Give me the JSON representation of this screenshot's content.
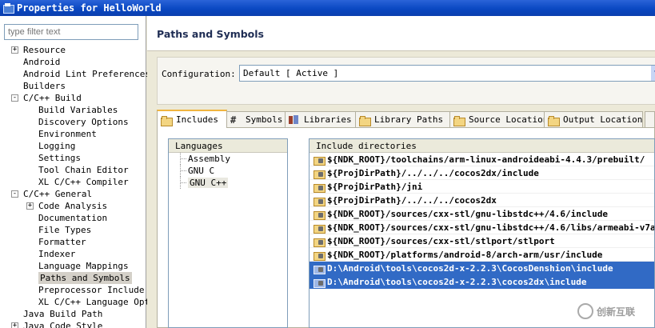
{
  "window": {
    "title": "Properties for HelloWorld"
  },
  "filter": {
    "placeholder": "type filter text"
  },
  "tree": {
    "items": [
      {
        "label": "Resource",
        "level": 0,
        "expander": "+"
      },
      {
        "label": "Android",
        "level": 0
      },
      {
        "label": "Android Lint Preferences",
        "level": 0
      },
      {
        "label": "Builders",
        "level": 0
      },
      {
        "label": "C/C++ Build",
        "level": 0,
        "expander": "-"
      },
      {
        "label": "Build Variables",
        "level": 1
      },
      {
        "label": "Discovery Options",
        "level": 1
      },
      {
        "label": "Environment",
        "level": 1
      },
      {
        "label": "Logging",
        "level": 1
      },
      {
        "label": "Settings",
        "level": 1
      },
      {
        "label": "Tool Chain Editor",
        "level": 1
      },
      {
        "label": "XL C/C++ Compiler",
        "level": 1
      },
      {
        "label": "C/C++ General",
        "level": 0,
        "expander": "-"
      },
      {
        "label": "Code Analysis",
        "level": 1,
        "expander": "+"
      },
      {
        "label": "Documentation",
        "level": 1
      },
      {
        "label": "File Types",
        "level": 1
      },
      {
        "label": "Formatter",
        "level": 1
      },
      {
        "label": "Indexer",
        "level": 1
      },
      {
        "label": "Language Mappings",
        "level": 1
      },
      {
        "label": "Paths and Symbols",
        "level": 1,
        "selected": true
      },
      {
        "label": "Preprocessor Include",
        "level": 1
      },
      {
        "label": "XL C/C++ Language Opt",
        "level": 1
      },
      {
        "label": "Java Build Path",
        "level": 0
      },
      {
        "label": "Java Code Style",
        "level": 0,
        "expander": "+"
      }
    ]
  },
  "page": {
    "title": "Paths and Symbols",
    "configuration_label": "Configuration:",
    "configuration_value": "Default  [ Active ]"
  },
  "tabs": [
    {
      "label": "Includes",
      "icon": "folder-icon",
      "active": true
    },
    {
      "label": "Symbols",
      "icon": "hash-icon"
    },
    {
      "label": "Libraries",
      "icon": "books-icon"
    },
    {
      "label": "Library Paths",
      "icon": "folder-icon"
    },
    {
      "label": "Source Location",
      "icon": "folder-icon"
    },
    {
      "label": "Output Location",
      "icon": "folder-icon"
    }
  ],
  "languages": {
    "header": "Languages",
    "items": [
      {
        "label": "Assembly"
      },
      {
        "label": "GNU C"
      },
      {
        "label": "GNU C++",
        "selected": true
      }
    ]
  },
  "include_dirs": {
    "header": "Include directories",
    "items": [
      {
        "path": "${NDK_ROOT}/toolchains/arm-linux-androideabi-4.4.3/prebuilt/"
      },
      {
        "path": "${ProjDirPath}/../../../cocos2dx/include"
      },
      {
        "path": "${ProjDirPath}/jni"
      },
      {
        "path": "${ProjDirPath}/../../../cocos2dx"
      },
      {
        "path": "${NDK_ROOT}/sources/cxx-stl/gnu-libstdc++/4.6/include"
      },
      {
        "path": "${NDK_ROOT}/sources/cxx-stl/gnu-libstdc++/4.6/libs/armeabi-v7a"
      },
      {
        "path": "${NDK_ROOT}/sources/cxx-stl/stlport/stlport"
      },
      {
        "path": "${NDK_ROOT}/platforms/android-8/arch-arm/usr/include"
      },
      {
        "path": "D:\\Android\\tools\\cocos2d-x-2.2.3\\CocosDenshion\\include",
        "selected": true
      },
      {
        "path": "D:\\Android\\tools\\cocos2d-x-2.2.3\\cocos2dx\\include",
        "selected": true
      }
    ]
  },
  "watermark": {
    "text": "创新互联"
  }
}
